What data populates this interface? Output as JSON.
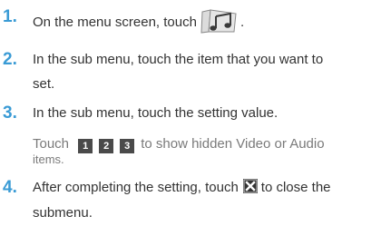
{
  "steps": [
    {
      "number": "1.",
      "before_icon": "On the menu screen, touch",
      "icon": "music-note-icon",
      "after_icon": "."
    },
    {
      "number": "2.",
      "line1": "In the sub menu, touch the item that you want to",
      "line2": "set."
    },
    {
      "number": "3.",
      "text": "In the sub menu, touch the setting value.",
      "note": {
        "before_buttons": "Touch",
        "buttons": [
          "1",
          "2",
          "3"
        ],
        "after_buttons": "to show hidden Video or Audio",
        "line2": "items."
      }
    },
    {
      "number": "4.",
      "before_icon": "After completing the setting, touch",
      "icon": "close-x-icon",
      "after_icon": "to close the",
      "line2": "submenu."
    }
  ],
  "colors": {
    "step_number": "#3a9bd5",
    "body_text": "#333333",
    "note_text": "#7a7a7a"
  }
}
